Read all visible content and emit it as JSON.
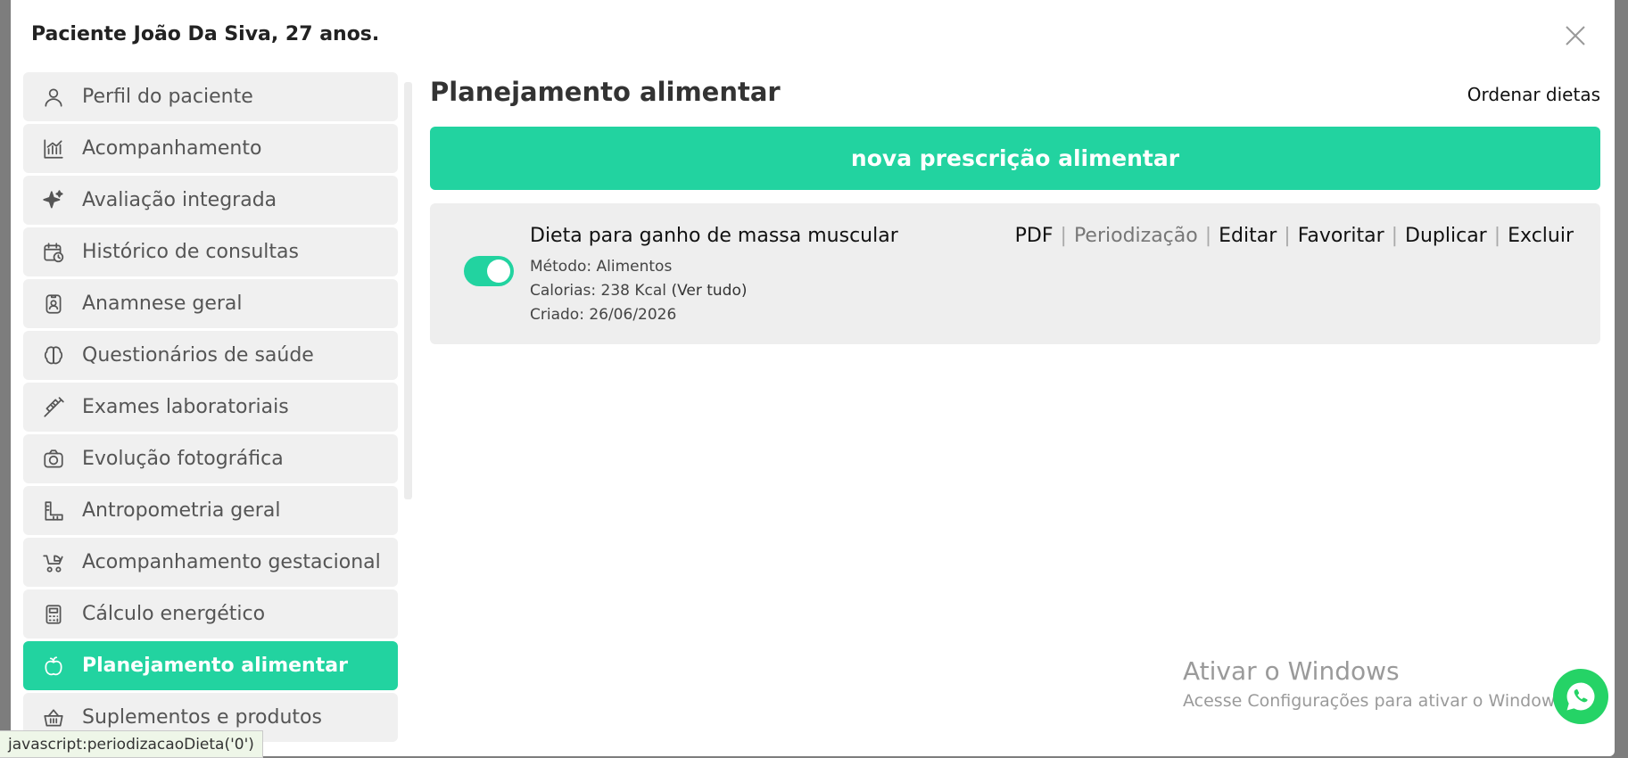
{
  "modal": {
    "title": "Paciente João Da Siva, 27 anos.",
    "close_icon": "close-icon"
  },
  "sidebar": {
    "items": [
      {
        "label": "Perfil do paciente",
        "icon": "user-icon"
      },
      {
        "label": "Acompanhamento",
        "icon": "chart-icon"
      },
      {
        "label": "Avaliação integrada",
        "icon": "sparkles-icon"
      },
      {
        "label": "Histórico de consultas",
        "icon": "calendar-clock-icon"
      },
      {
        "label": "Anamnese geral",
        "icon": "id-badge-icon"
      },
      {
        "label": "Questionários de saúde",
        "icon": "brain-icon"
      },
      {
        "label": "Exames laboratoriais",
        "icon": "syringe-icon"
      },
      {
        "label": "Evolução fotográfica",
        "icon": "camera-icon"
      },
      {
        "label": "Antropometria geral",
        "icon": "ruler-icon"
      },
      {
        "label": "Acompanhamento gestacional",
        "icon": "stroller-icon"
      },
      {
        "label": "Cálculo energético",
        "icon": "calculator-icon"
      },
      {
        "label": "Planejamento alimentar",
        "icon": "apple-icon",
        "active": true
      },
      {
        "label": "Suplementos e produtos",
        "icon": "basket-icon"
      }
    ]
  },
  "main": {
    "title": "Planejamento alimentar",
    "order_link": "Ordenar dietas",
    "new_button": "nova prescrição alimentar"
  },
  "diet": {
    "enabled": true,
    "name": "Dieta para ganho de massa muscular",
    "method": "Método: Alimentos",
    "calories": "Calorias: 238 Kcal",
    "see_all": "(Ver tudo)",
    "created": "Criado: 26/06/2026",
    "actions": {
      "pdf": "PDF",
      "periodization": "Periodização",
      "edit": "Editar",
      "favorite": "Favoritar",
      "duplicate": "Duplicar",
      "delete": "Excluir",
      "separator": "|"
    }
  },
  "watermark": {
    "title": "Ativar o Windows",
    "subtitle": "Acesse Configurações para ativar o Windows."
  },
  "status_bar": {
    "url": "javascript:periodizacaoDieta('0')"
  },
  "colors": {
    "accent": "#22d3a0",
    "item_bg": "#f0f0f0",
    "card_bg": "#eeeeee"
  }
}
